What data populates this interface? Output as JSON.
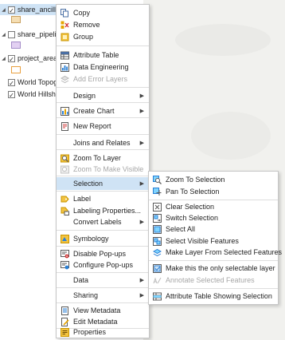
{
  "toc": {
    "layers": [
      {
        "name": "share_ancillary",
        "checked": true,
        "expanded": true,
        "selected": true,
        "swatch": "#f5deb3",
        "swatch_border": "#c8a060"
      },
      {
        "name": "share_pipeline",
        "checked": false,
        "expanded": true,
        "selected": false,
        "swatch": "#e2d0f2",
        "swatch_border": "#a48cc8"
      },
      {
        "name": "project_area",
        "checked": true,
        "expanded": true,
        "selected": false,
        "swatch": "#ffffff",
        "swatch_border": "#e8a040"
      },
      {
        "name": "World Topographic",
        "checked": true,
        "expanded": false,
        "selected": false
      },
      {
        "name": "World Hillshade",
        "checked": true,
        "expanded": false,
        "selected": false
      }
    ]
  },
  "context_menu": {
    "items": [
      {
        "label": "Copy",
        "icon": "copy-icon",
        "disabled": false
      },
      {
        "label": "Remove",
        "icon": "remove-icon",
        "disabled": false
      },
      {
        "label": "Group",
        "icon": "group-icon",
        "disabled": false
      },
      {
        "label": "Attribute Table",
        "icon": "table-icon",
        "disabled": false
      },
      {
        "label": "Data Engineering",
        "icon": "data-engineering-icon",
        "disabled": false
      },
      {
        "label": "Add Error Layers",
        "icon": "error-layers-icon",
        "disabled": true
      },
      {
        "label": "Design",
        "submenu": true
      },
      {
        "label": "Create Chart",
        "icon": "chart-icon",
        "submenu": true
      },
      {
        "label": "New Report",
        "icon": "report-icon"
      },
      {
        "label": "Joins and Relates",
        "submenu": true
      },
      {
        "label": "Zoom To Layer",
        "icon": "zoom-layer-icon"
      },
      {
        "label": "Zoom To Make Visible",
        "icon": "zoom-visible-icon",
        "disabled": true
      },
      {
        "label": "Selection",
        "submenu": true,
        "highlight": true
      },
      {
        "label": "Label",
        "icon": "label-icon"
      },
      {
        "label": "Labeling Properties...",
        "icon": "labeling-properties-icon"
      },
      {
        "label": "Convert Labels",
        "submenu": true
      },
      {
        "label": "Symbology",
        "icon": "symbology-icon"
      },
      {
        "label": "Disable Pop-ups",
        "icon": "disable-popups-icon"
      },
      {
        "label": "Configure Pop-ups",
        "icon": "configure-popups-icon"
      },
      {
        "label": "Data",
        "submenu": true
      },
      {
        "label": "Sharing",
        "submenu": true
      },
      {
        "label": "View Metadata",
        "icon": "view-metadata-icon"
      },
      {
        "label": "Edit Metadata",
        "icon": "edit-metadata-icon"
      },
      {
        "label": "Properties",
        "icon": "properties-icon"
      }
    ]
  },
  "selection_submenu": {
    "items": [
      {
        "label": "Zoom To Selection",
        "icon": "zoom-selection-icon"
      },
      {
        "label": "Pan To Selection",
        "icon": "pan-selection-icon"
      },
      {
        "label": "Clear Selection",
        "icon": "clear-selection-icon"
      },
      {
        "label": "Switch Selection",
        "icon": "switch-selection-icon"
      },
      {
        "label": "Select All",
        "icon": "select-all-icon"
      },
      {
        "label": "Select Visible Features",
        "icon": "select-visible-icon"
      },
      {
        "label": "Make Layer From Selected Features",
        "icon": "make-layer-icon"
      },
      {
        "label": "Make this the only selectable layer",
        "icon": "only-selectable-icon"
      },
      {
        "label": "Annotate Selected Features",
        "icon": "annotate-icon",
        "disabled": true
      },
      {
        "label": "Attribute Table Showing Selection",
        "icon": "attribute-selection-icon"
      }
    ]
  },
  "colors": {
    "highlight": "#cfe3f5",
    "accent": "#2a7fd4",
    "icon_gold": "#e6a400"
  }
}
